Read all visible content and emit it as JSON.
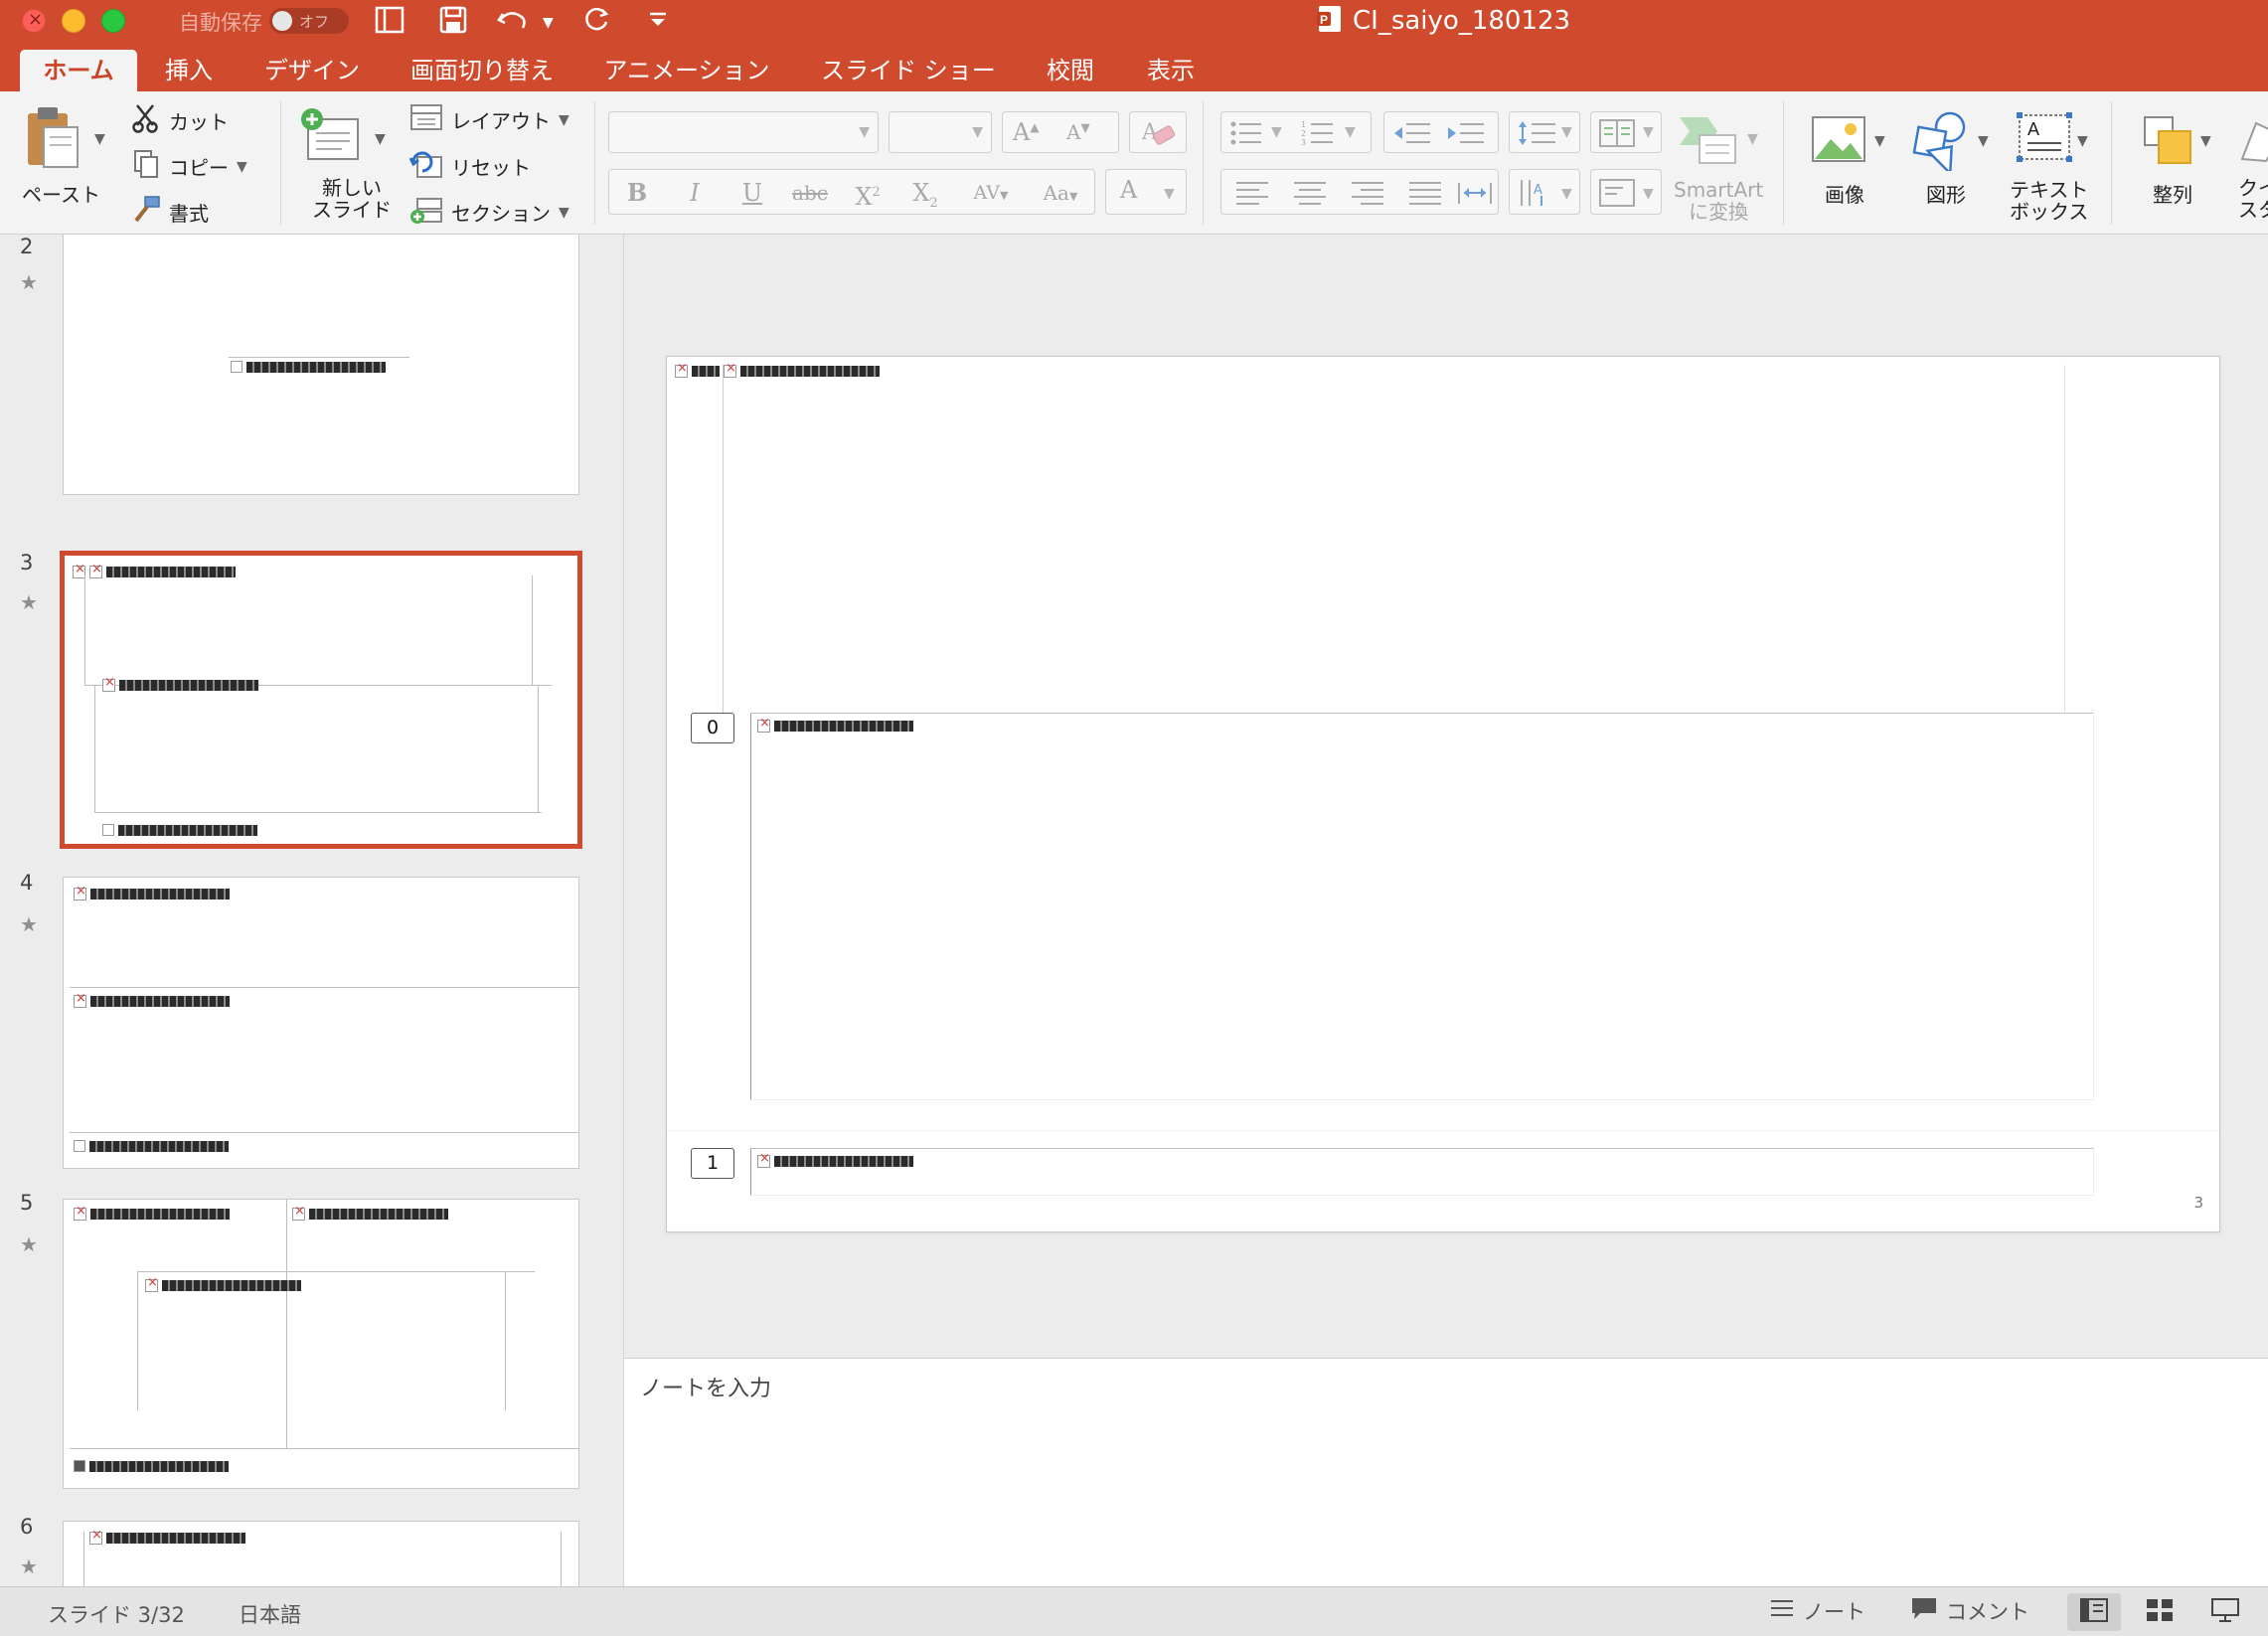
{
  "window": {
    "doc_title": "CI_saiyo_180123",
    "autosave_label": "自動保存",
    "autosave_state": "オフ"
  },
  "tabs": [
    {
      "label": "ホーム",
      "active": true
    },
    {
      "label": "挿入"
    },
    {
      "label": "デザイン"
    },
    {
      "label": "画面切り替え"
    },
    {
      "label": "アニメーション"
    },
    {
      "label": "スライド ショー"
    },
    {
      "label": "校閲"
    },
    {
      "label": "表示"
    }
  ],
  "ribbon": {
    "paste": "ペースト",
    "cut": "カット",
    "copy": "コピー",
    "format_painter": "書式",
    "new_slide_line1": "新しい",
    "new_slide_line2": "スライド",
    "layout": "レイアウト",
    "reset": "リセット",
    "section": "セクション",
    "smartart_line1": "SmartArt",
    "smartart_line2": "に変換",
    "image": "画像",
    "shapes": "図形",
    "textbox_line1": "テキスト",
    "textbox_line2": "ボックス",
    "arrange": "整列",
    "quick_styles_partial": "クイ",
    "quick_styles_partial2": "スタ"
  },
  "thumbnails": [
    {
      "num": "2"
    },
    {
      "num": "3",
      "selected": true
    },
    {
      "num": "4"
    },
    {
      "num": "5"
    },
    {
      "num": "6"
    }
  ],
  "slide": {
    "box0": "0",
    "box1": "1",
    "page_number": "3"
  },
  "notes": {
    "placeholder": "ノートを入力"
  },
  "status": {
    "slide_info": "スライド 3/32",
    "language": "日本語",
    "notes_btn": "ノート",
    "comments_btn": "コメント"
  },
  "colors": {
    "accent": "#d04a2e"
  }
}
